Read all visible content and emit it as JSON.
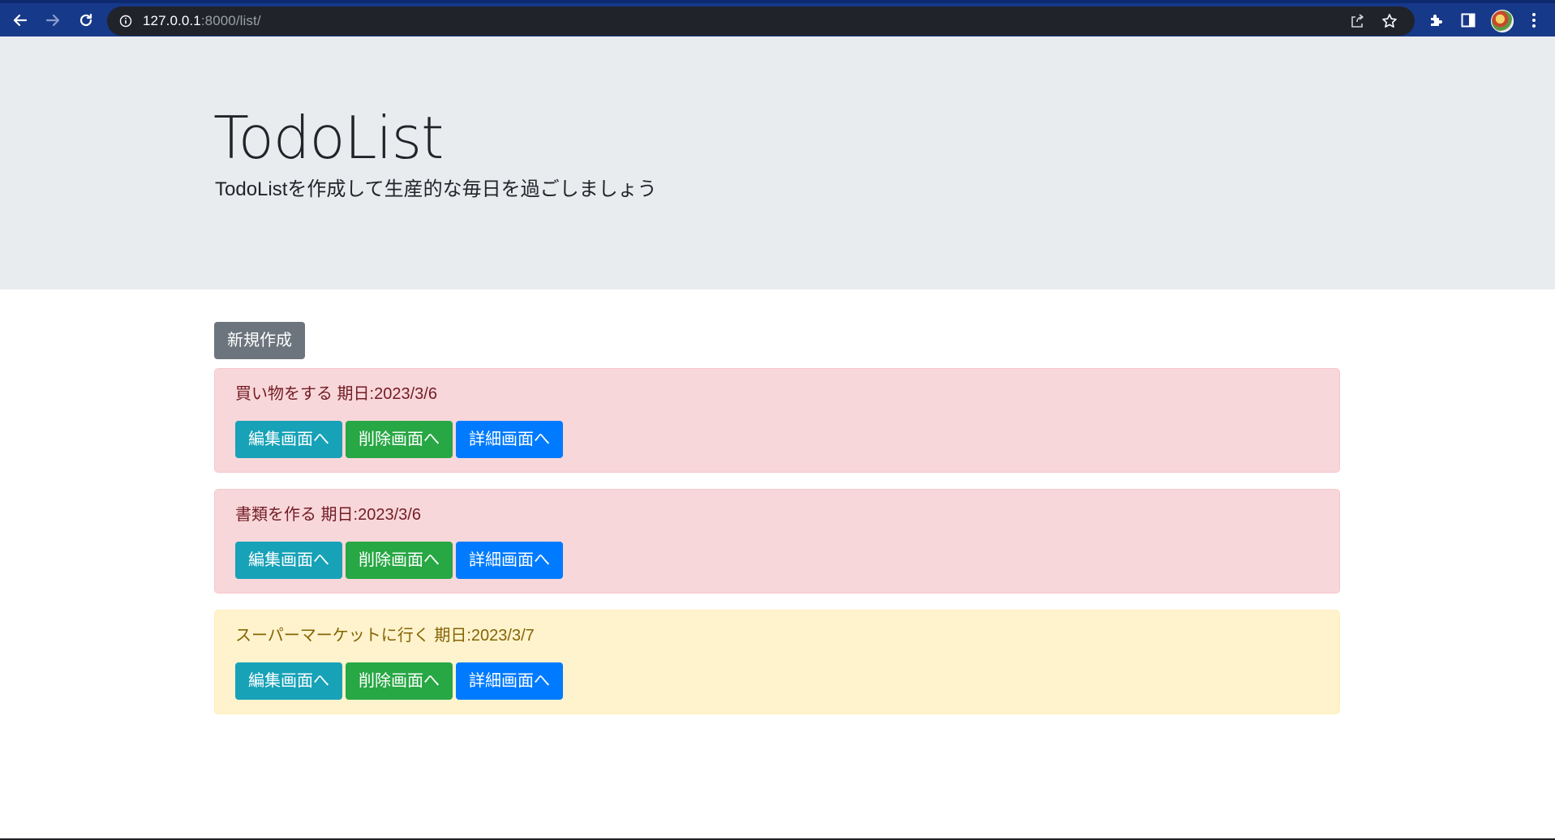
{
  "browser": {
    "url_host": "127.0.0.1",
    "url_path": ":8000/list/",
    "icons": [
      "back-icon",
      "forward-icon",
      "reload-icon",
      "site-info-icon",
      "share-icon",
      "bookmark-star-icon",
      "extensions-icon",
      "side-panel-icon",
      "profile-avatar",
      "more-menu-icon"
    ]
  },
  "header": {
    "title": "TodoList",
    "lead": "TodoListを作成して生産的な毎日を過ごしましょう"
  },
  "actions": {
    "new_label": "新規作成"
  },
  "todos": [
    {
      "text": "買い物をする 期日:2023/3/6",
      "status": "danger",
      "color": "#f8d7da"
    },
    {
      "text": "書類を作る 期日:2023/3/6",
      "status": "danger",
      "color": "#f8d7da"
    },
    {
      "text": "スーパーマーケットに行く 期日:2023/3/7",
      "status": "warning",
      "color": "#fff3cd"
    }
  ],
  "item_buttons": {
    "edit": "編集画面へ",
    "delete": "削除画面へ",
    "detail": "詳細画面へ"
  },
  "colors": {
    "edit": "#17a2b8",
    "delete": "#28a745",
    "detail": "#007bff",
    "new": "#6c757d"
  }
}
